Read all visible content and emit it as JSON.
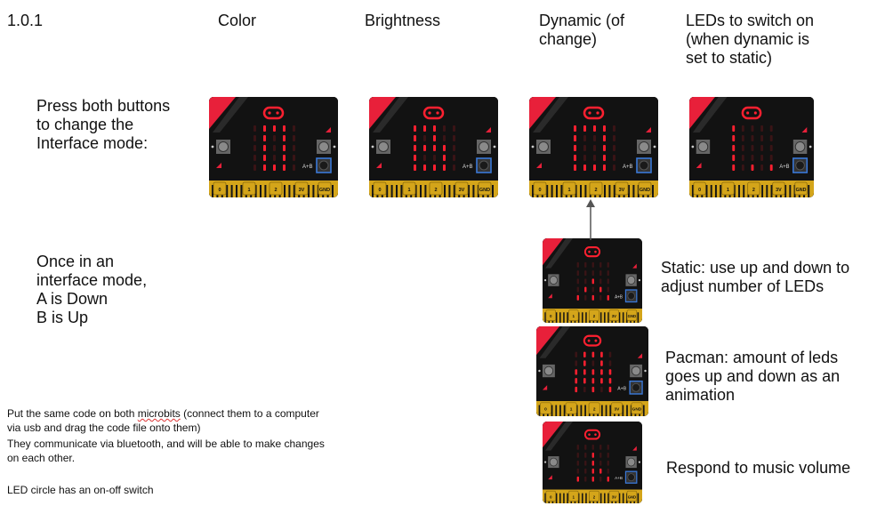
{
  "version": "1.0.1",
  "columns": {
    "color": "Color",
    "brightness": "Brightness",
    "dynamic": "Dynamic (of\nchange)",
    "leds": "LEDs to switch on\n(when dynamic is\nset to static)"
  },
  "instructions": {
    "press_both": "Press both buttons\nto change the\nInterface mode:",
    "interface_mode": "Once in an\ninterface mode,\nA is Down\nB is Up"
  },
  "modes": {
    "static": "Static: use up and down to\nadjust number of LEDs",
    "pacman": "Pacman: amount of leds\ngoes up and down as an\nanimation",
    "music": "Respond to music volume"
  },
  "notes": {
    "line1_pre": "Put the same code on both ",
    "line1_word": "microbits",
    "line1_post": " (connect them to a computer\nvia usb and drag the code file onto them)",
    "line2": "They communicate via bluetooth, and will be able to make changes\non each other.",
    "line3": "LED circle has an on-off switch"
  },
  "board": {
    "ab_label": "A+B",
    "pins": [
      "0",
      "1",
      "2",
      "3V",
      "GND"
    ]
  },
  "colors": {
    "board_bg": "#121212",
    "led_on": "#ff2030",
    "led_off": "#3a1416",
    "corner_red": "#e8203a",
    "gold": "#d4a51a",
    "button_a": "#8a8a8a",
    "button_b_outline": "#3a78d8"
  },
  "boards": [
    {
      "id": "color",
      "rows": [
        "01110",
        "01010",
        "01010",
        "01010",
        "01110"
      ]
    },
    {
      "id": "brightness",
      "rows": [
        "11100",
        "10100",
        "11110",
        "10010",
        "11110"
      ]
    },
    {
      "id": "dynamic",
      "rows": [
        "11110",
        "10010",
        "10010",
        "10010",
        "11110"
      ]
    },
    {
      "id": "leds",
      "rows": [
        "10000",
        "10000",
        "10000",
        "10000",
        "10101"
      ]
    },
    {
      "id": "static",
      "rows": [
        "00000",
        "00000",
        "00100",
        "01010",
        "10101"
      ]
    },
    {
      "id": "pacman",
      "rows": [
        "01110",
        "01010",
        "11111",
        "11111",
        "10101"
      ]
    },
    {
      "id": "music",
      "rows": [
        "00000",
        "00100",
        "00100",
        "00110",
        "10101"
      ]
    }
  ]
}
